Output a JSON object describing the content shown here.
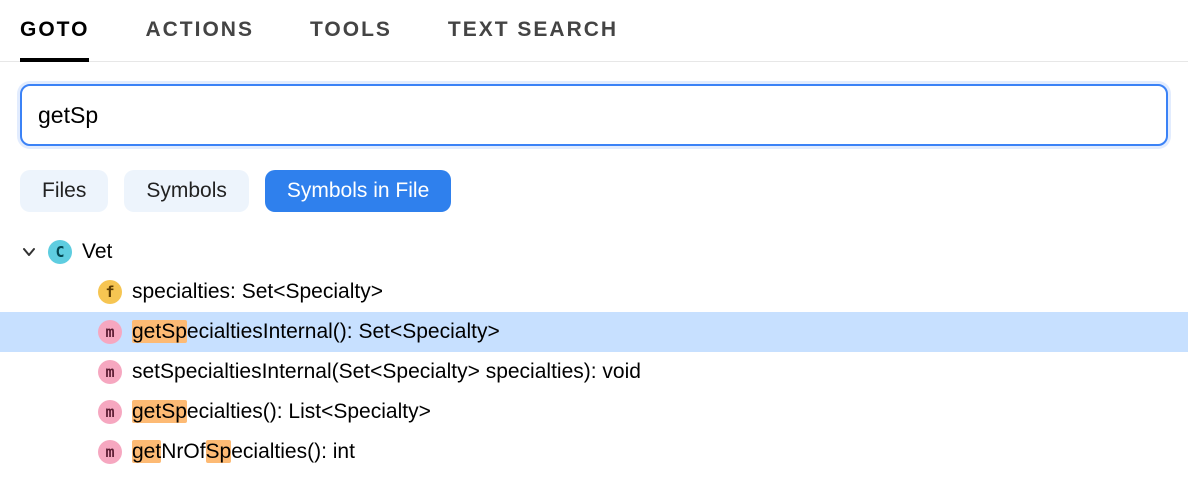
{
  "tabs": {
    "goto": "GOTO",
    "actions": "ACTIONS",
    "tools": "TOOLS",
    "text_search": "TEXT SEARCH",
    "active": "goto"
  },
  "search": {
    "value": "getSp"
  },
  "filters": {
    "files": "Files",
    "symbols": "Symbols",
    "symbols_in_file": "Symbols in File",
    "active": "symbols_in_file"
  },
  "icon_letters": {
    "class": "C",
    "field": "f",
    "method": "m"
  },
  "tree": {
    "root": {
      "kind": "class",
      "name_pre": "",
      "name_hl": "",
      "name_post": "Vet"
    },
    "children": [
      {
        "kind": "field",
        "selected": false,
        "pre": "",
        "hl1": "",
        "mid1": "specialties: Set<Specialty>",
        "hl2": "",
        "mid2": "",
        "hl3": "",
        "post": ""
      },
      {
        "kind": "method",
        "selected": true,
        "pre": "",
        "hl1": "getSp",
        "mid1": "ecialtiesInternal(): Set<Specialty>",
        "hl2": "",
        "mid2": "",
        "hl3": "",
        "post": ""
      },
      {
        "kind": "method",
        "selected": false,
        "pre": "",
        "hl1": "",
        "mid1": "setSpecialtiesInternal(Set<Specialty> specialties): void",
        "hl2": "",
        "mid2": "",
        "hl3": "",
        "post": ""
      },
      {
        "kind": "method",
        "selected": false,
        "pre": "",
        "hl1": "getSp",
        "mid1": "ecialties(): List<Specialty>",
        "hl2": "",
        "mid2": "",
        "hl3": "",
        "post": ""
      },
      {
        "kind": "method",
        "selected": false,
        "pre": "",
        "hl1": "get",
        "mid1": "NrOf",
        "hl2": "Sp",
        "mid2": "ecialties(): int",
        "hl3": "",
        "post": ""
      }
    ]
  }
}
